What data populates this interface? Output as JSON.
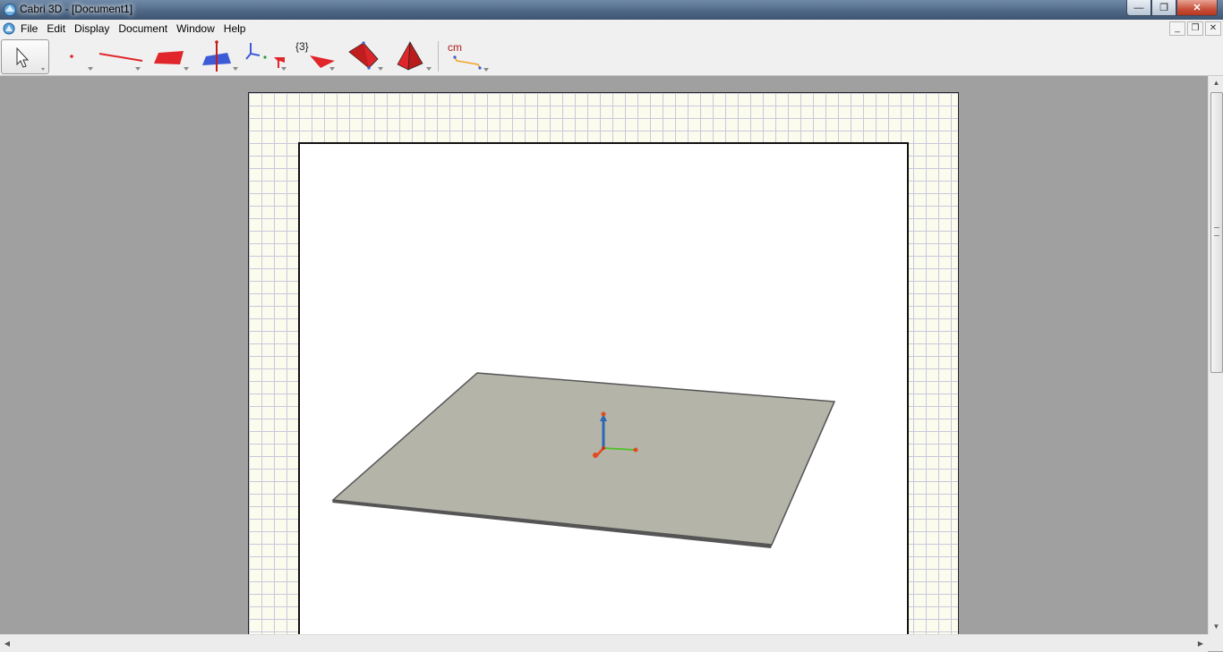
{
  "window": {
    "title": "Cabri 3D - [Document1]",
    "buttons": {
      "minimize": "—",
      "maximize": "❐",
      "close": "✕"
    }
  },
  "menu": {
    "items": [
      "File",
      "Edit",
      "Display",
      "Document",
      "Window",
      "Help"
    ],
    "mdi_buttons": {
      "minimize": "_",
      "restore": "❐",
      "close": "✕"
    }
  },
  "toolbar": {
    "tools": [
      {
        "name": "pointer",
        "icon": "pointer-arrow-icon"
      },
      {
        "name": "points",
        "icon": "point-icon"
      },
      {
        "name": "curves",
        "icon": "line-icon"
      },
      {
        "name": "surfaces",
        "icon": "plane-icon"
      },
      {
        "name": "relative-constructions",
        "icon": "perpendicular-icon"
      },
      {
        "name": "transformations",
        "icon": "axes-transform-icon"
      },
      {
        "name": "regular-polygons",
        "icon": "polygon-icon"
      },
      {
        "name": "polyhedra",
        "icon": "polyhedron-icon"
      },
      {
        "name": "regular-polyhedra",
        "icon": "pyramid-icon"
      },
      {
        "name": "measurement",
        "icon": "measure-cm-icon"
      }
    ],
    "sets_label": "{3}",
    "measure_label": "cm"
  },
  "colors": {
    "tool_red": "#e0262a",
    "tool_blue": "#3d5bd6",
    "plane_fill": "#b4b4a9",
    "axis_x": "#e24a1f",
    "axis_y": "#4cc21f",
    "axis_z": "#2c67b6"
  },
  "scene": {
    "objects": [
      "base-plane",
      "origin-axes"
    ]
  }
}
